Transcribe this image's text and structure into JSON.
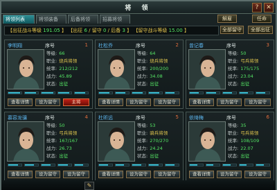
{
  "window": {
    "title": "将 领",
    "help_icon": "?",
    "close_icon": "✕"
  },
  "tabs": [
    {
      "label": "将领列表",
      "active": true
    },
    {
      "label": "将领装备",
      "active": false
    },
    {
      "label": "后备将领",
      "active": false
    },
    {
      "label": "招募将领",
      "active": false
    }
  ],
  "buttons": {
    "dismiss": "解雇",
    "promote": "任命",
    "all_stay": "全部留守",
    "all_out": "全部出征"
  },
  "stats": {
    "power_label": "【出征战斗等级",
    "power_value": "191.05",
    "power_end": "】",
    "out_label": "【出征",
    "out_value": "6",
    "stay_label": "/ 留守",
    "stay_value": "0",
    "reserve_label": "/ 后备",
    "reserve_value": "3",
    "reserve_end": "】",
    "stay_power_label": "【留守战斗等级",
    "stay_power_value": "15.00",
    "stay_power_end": "】"
  },
  "labels": {
    "seq": "序号",
    "level": "等级:",
    "job": "职业:",
    "lead": "统率:",
    "power": "战力:",
    "state": "状态:",
    "detail": "查看详情",
    "set_stay": "设为留守",
    "main_btn": "主将"
  },
  "generals": [
    {
      "name": "李明翔",
      "seq": "1",
      "level": "66",
      "job": "烧兵将领",
      "lead": "212/212",
      "power": "45.89",
      "state": "出征",
      "third_btn": "主将",
      "third_red": true,
      "bars": [
        0.9,
        0.85,
        0.9,
        0.85,
        0.8
      ]
    },
    {
      "name": "杜松乔",
      "seq": "2",
      "level": "64",
      "job": "烧兵将领",
      "lead": "200/200",
      "power": "34.08",
      "state": "出征",
      "third_btn": "设为留守",
      "third_red": false,
      "bars": [
        0.8,
        0.75,
        0.8,
        0.8,
        0.7
      ]
    },
    {
      "name": "曾记春",
      "seq": "3",
      "level": "50",
      "job": "弓兵将领",
      "lead": "175/175",
      "power": "23.04",
      "state": "出征",
      "third_btn": "设为留守",
      "third_red": false,
      "bars": [
        0.7,
        0.75,
        0.7,
        0.65,
        0.7
      ]
    },
    {
      "name": "慕容龙骧",
      "seq": "4",
      "level": "50",
      "job": "弓兵将领",
      "lead": "167/167",
      "power": "26.73",
      "state": "出征",
      "third_btn": "设为留守",
      "third_red": false,
      "bars": [
        0.75,
        0.7,
        0.7,
        0.75,
        0.65
      ]
    },
    {
      "name": "杜昕远",
      "seq": "5",
      "level": "53",
      "job": "骑兵将领",
      "lead": "270/270",
      "power": "24.24",
      "state": "出征",
      "third_btn": "设为留守",
      "third_red": false,
      "bars": [
        0.7,
        0.65,
        0.7,
        0.75,
        0.7
      ]
    },
    {
      "name": "依绮梅",
      "seq": "6",
      "level": "35",
      "job": "弓兵将领",
      "lead": "108/109",
      "power": "22.07",
      "state": "出征",
      "third_btn": "设为留守",
      "third_red": false,
      "bars": [
        0.6,
        0.55,
        0.6,
        0.55,
        0.6
      ]
    }
  ]
}
